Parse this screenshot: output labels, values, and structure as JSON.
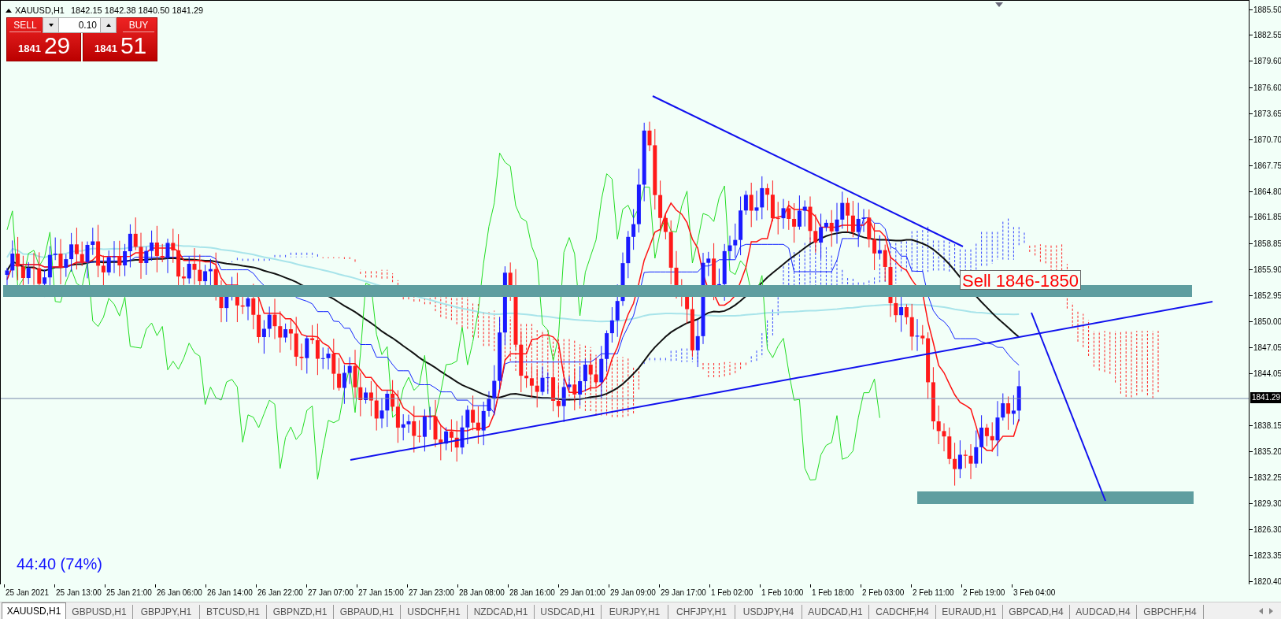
{
  "chart_header": {
    "symbol": "XAUUSD,H1",
    "ohlc": "1842.15 1842.38 1840.50 1841.29"
  },
  "trade_panel": {
    "sell_label": "SELL",
    "buy_label": "BUY",
    "lot_size": "0.10",
    "bid_main": "1841",
    "bid_pips": "29",
    "ask_main": "1841",
    "ask_pips": "51"
  },
  "annotation": "Sell 1846-1850",
  "countdown": "44:40 (74%)",
  "current_price": "1841.29",
  "price_axis": [
    "1885.50",
    "1882.55",
    "1879.60",
    "1876.60",
    "1873.65",
    "1870.70",
    "1867.75",
    "1864.80",
    "1861.85",
    "1858.85",
    "1855.90",
    "1852.95",
    "1850.00",
    "1847.05",
    "1844.05",
    "1838.15",
    "1835.20",
    "1832.25",
    "1829.30",
    "1826.30",
    "1823.35",
    "1820.40"
  ],
  "time_axis": [
    "25 Jan 2021",
    "25 Jan 13:00",
    "25 Jan 21:00",
    "26 Jan 06:00",
    "26 Jan 14:00",
    "26 Jan 22:00",
    "27 Jan 07:00",
    "27 Jan 15:00",
    "27 Jan 23:00",
    "28 Jan 08:00",
    "28 Jan 16:00",
    "29 Jan 01:00",
    "29 Jan 09:00",
    "29 Jan 17:00",
    "1 Feb 02:00",
    "1 Feb 10:00",
    "1 Feb 18:00",
    "2 Feb 03:00",
    "2 Feb 11:00",
    "2 Feb 19:00",
    "3 Feb 04:00"
  ],
  "tabs": [
    {
      "label": "XAUUSD,H1",
      "selected": true
    },
    {
      "label": "GBPUSD,H1",
      "selected": false
    },
    {
      "label": "GBPJPY,H1",
      "selected": false
    },
    {
      "label": "BTCUSD,H1",
      "selected": false
    },
    {
      "label": "GBPNZD,H1",
      "selected": false
    },
    {
      "label": "GBPAUD,H1",
      "selected": false
    },
    {
      "label": "USDCHF,H1",
      "selected": false
    },
    {
      "label": "NZDCAD,H1",
      "selected": false
    },
    {
      "label": "USDCAD,H1",
      "selected": false
    },
    {
      "label": "EURJPY,H1",
      "selected": false
    },
    {
      "label": "CHFJPY,H1",
      "selected": false
    },
    {
      "label": "USDJPY,H4",
      "selected": false
    },
    {
      "label": "AUDCAD,H1",
      "selected": false
    },
    {
      "label": "CADCHF,H4",
      "selected": false
    },
    {
      "label": "EURAUD,H1",
      "selected": false
    },
    {
      "label": "GBPCAD,H4",
      "selected": false
    },
    {
      "label": "AUDCAD,H4",
      "selected": false
    },
    {
      "label": "GBPCHF,H4",
      "selected": false
    }
  ]
}
